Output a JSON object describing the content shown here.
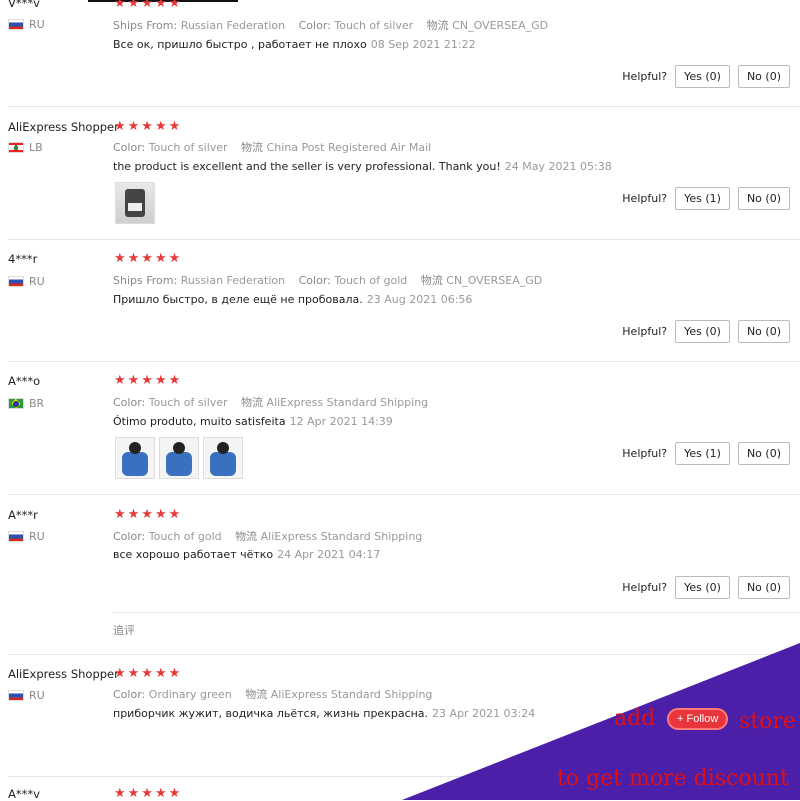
{
  "ui": {
    "helpful_label": "Helpful?",
    "followup_label": "追评"
  },
  "reviews": [
    {
      "user": "V***v",
      "country": "RU",
      "flag": "ru",
      "stars": "★★★★★",
      "info": [
        {
          "k": "Ships From:",
          "v": "Russian Federation"
        },
        {
          "k": "Color:",
          "v": "Touch of silver"
        },
        {
          "k": "物流",
          "v": "CN_OVERSEA_GD"
        }
      ],
      "text": "Все ок, пришло быстро , работает не плохо",
      "date": "08 Sep 2021 21:22",
      "yes": "Yes (0)",
      "no": "No (0)"
    },
    {
      "user": "AliExpress Shopper",
      "country": "LB",
      "flag": "lb",
      "stars": "★★★★★",
      "info": [
        {
          "k": "Color:",
          "v": "Touch of silver"
        },
        {
          "k": "物流",
          "v": "China Post Registered Air Mail"
        }
      ],
      "text": "the product is excellent and the seller is very professional. Thank you!",
      "date": "24 May 2021 05:38",
      "yes": "Yes (1)",
      "no": "No (0)"
    },
    {
      "user": "4***r",
      "country": "RU",
      "flag": "ru",
      "stars": "★★★★★",
      "info": [
        {
          "k": "Ships From:",
          "v": "Russian Federation"
        },
        {
          "k": "Color:",
          "v": "Touch of gold"
        },
        {
          "k": "物流",
          "v": "CN_OVERSEA_GD"
        }
      ],
      "text": "Пришло быстро, в деле ещё не пробовала.",
      "date": "23 Aug 2021 06:56",
      "yes": "Yes (0)",
      "no": "No (0)"
    },
    {
      "user": "A***o",
      "country": "BR",
      "flag": "br",
      "stars": "★★★★★",
      "info": [
        {
          "k": "Color:",
          "v": "Touch of silver"
        },
        {
          "k": "物流",
          "v": "AliExpress Standard Shipping"
        }
      ],
      "text": "Ótimo produto, muito satisfeita",
      "date": "12 Apr 2021 14:39",
      "yes": "Yes (1)",
      "no": "No (0)"
    },
    {
      "user": "A***r",
      "country": "RU",
      "flag": "ru",
      "stars": "★★★★★",
      "info": [
        {
          "k": "Color:",
          "v": "Touch of gold"
        },
        {
          "k": "物流",
          "v": "AliExpress Standard Shipping"
        }
      ],
      "text": "все хорошо работает чётко",
      "date": "24 Apr 2021 04:17",
      "yes": "Yes (0)",
      "no": "No (0)"
    },
    {
      "user": "AliExpress Shopper",
      "country": "RU",
      "flag": "ru",
      "stars": "★★★★★",
      "info": [
        {
          "k": "Color:",
          "v": "Ordinary green"
        },
        {
          "k": "物流",
          "v": "AliExpress Standard Shipping"
        }
      ],
      "text": "приборчик жужит, водичка льётся, жизнь прекрасна.",
      "date": "23 Apr 2021 03:24"
    },
    {
      "user": "A***v",
      "stars": "★★★★★"
    }
  ],
  "promo": {
    "add": "add",
    "follow": "+ Follow",
    "store": "store",
    "discount": "to get more discount",
    "accent": "#4b1fa8",
    "text_color": "#e01010"
  }
}
